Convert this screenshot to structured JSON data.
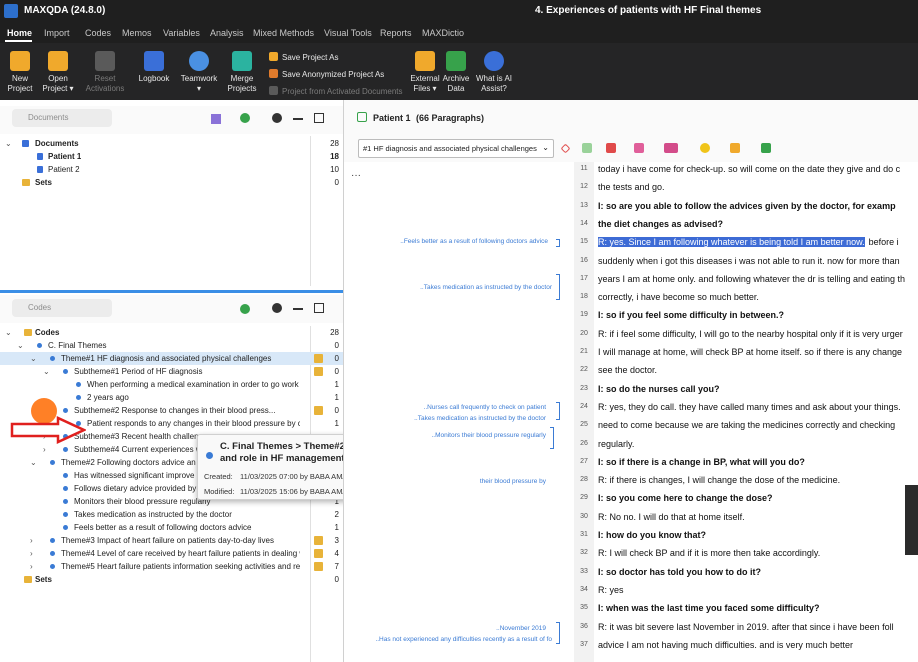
{
  "titlebar": {
    "app": "MAXQDA (24.8.0)",
    "document": "4. Experiences of patients with HF Final themes"
  },
  "menu_tabs": [
    "Home",
    "Import",
    "Codes",
    "Memos",
    "Variables",
    "Analysis",
    "Mixed Methods",
    "Visual Tools",
    "Reports",
    "MAXDictio"
  ],
  "ribbon": {
    "new_project": [
      "New",
      "Project"
    ],
    "open_project": [
      "Open",
      "Project ▾"
    ],
    "reset_activations": [
      "Reset",
      "Activations"
    ],
    "logbook": "Logbook",
    "teamwork": [
      "Teamwork",
      "▾"
    ],
    "merge_projects": [
      "Merge",
      "Projects"
    ],
    "save_project_as": "Save Project As",
    "save_anonymized": "Save Anonymized Project As",
    "project_from_activated": "Project from Activated Documents",
    "external_files": [
      "External",
      "Files ▾"
    ],
    "archive_data": [
      "Archive",
      "Data"
    ],
    "what_is_ai": [
      "What is AI",
      "Assist?"
    ]
  },
  "documents_panel": {
    "search_placeholder": "Documents",
    "rows": [
      {
        "label": "Documents",
        "count": "28"
      },
      {
        "label": "Patient 1",
        "count": "18"
      },
      {
        "label": "Patient 2",
        "count": "10"
      },
      {
        "label": "Sets",
        "count": "0"
      }
    ]
  },
  "codes_panel": {
    "search_placeholder": "Codes",
    "rows": [
      {
        "label": "Codes",
        "count": "28"
      },
      {
        "label": "C. Final Themes",
        "count": "0"
      },
      {
        "label": "Theme#1 HF diagnosis and associated physical challenges",
        "count": "0"
      },
      {
        "label": "Subtheme#1 Period of HF diagnosis",
        "count": "0"
      },
      {
        "label": "When performing a medical examination in order to go work ...",
        "count": "1"
      },
      {
        "label": "2 years ago",
        "count": "1"
      },
      {
        "label": "Subtheme#2 Response to changes in their blood press...",
        "count": "0"
      },
      {
        "label": "Patient responds to any changes in their blood pressure by ch...",
        "count": "1"
      },
      {
        "label": "Subtheme#3 Recent health challen",
        "count": ""
      },
      {
        "label": "Subtheme#4 Current experiences w",
        "count": ""
      },
      {
        "label": "Theme#2 Following doctors advice an",
        "count": ""
      },
      {
        "label": "Has witnessed significant improve",
        "count": ""
      },
      {
        "label": "Follows dietary advice provided by",
        "count": ""
      },
      {
        "label": "Monitors their blood pressure regularly",
        "count": "1"
      },
      {
        "label": "Takes medication as instructed by the doctor",
        "count": "2"
      },
      {
        "label": "Feels better as a result of following doctors advice",
        "count": "1"
      },
      {
        "label": "Theme#3 Impact of heart failure on patients day-to-day lives",
        "count": "3"
      },
      {
        "label": "Theme#4 Level of care received  by heart failure patients in  dealing wi...",
        "count": "4"
      },
      {
        "label": "Theme#5 Heart failure patients information seeking activities and reso...",
        "count": "7"
      },
      {
        "label": "Sets",
        "count": "0"
      }
    ]
  },
  "tooltip": {
    "title": "C. Final Themes > Theme#2 Following doctors advice and role in HF management",
    "created_label": "Created:",
    "created_value": "11/03/2025 07:00 by BABA AMARI",
    "modified_label": "Modified:",
    "modified_value": "11/03/2025 15:06 by BABA AMARI"
  },
  "document_browser": {
    "title": "Patient 1",
    "paragraphs": "(66 Paragraphs)",
    "code_selector": "#1 HF diagnosis and associated physical challenges",
    "margin_labels": [
      "..Feels better as a result of following doctors advice",
      "..Takes medication as instructed by the doctor",
      "..Nurses call frequently to check on patient",
      "..Takes medication as instructed by the doctor",
      "..Monitors their blood pressure regularly",
      "their blood pressure by",
      "..November 2019",
      "..Has not experienced any difficulties recently as a result of fo"
    ],
    "lines": [
      {
        "n": "11",
        "text": "today i have come for check-up. so will come on the date they give and do c",
        "bold": false
      },
      {
        "n": "12",
        "text": "the tests and go.",
        "bold": false
      },
      {
        "n": "13",
        "text": "I: so are you able to follow the advices given by the doctor, for examp",
        "bold": true
      },
      {
        "n": "14",
        "text": "the diet changes as advised?",
        "bold": true
      },
      {
        "n": "15",
        "text": "before i",
        "bold": false,
        "highlight": "R: yes. Since I am following whatever is being told I am better now."
      },
      {
        "n": "16",
        "text": "suddenly when i got this diseases i was not able to run it. now for more than",
        "bold": false
      },
      {
        "n": "17",
        "text": "years I am at home only. and following whatever the dr is telling and eating th",
        "bold": false
      },
      {
        "n": "18",
        "text": "correctly, i have become so much better.",
        "bold": false
      },
      {
        "n": "19",
        "text": "I: so if you feel some difficulty in between.?",
        "bold": true
      },
      {
        "n": "20",
        "text": "R: if i feel some difficulty, I will go to the nearby hospital only if it is very urger",
        "bold": false
      },
      {
        "n": "21",
        "text": "I will manage at home, will check BP at home itself. so if there is any change",
        "bold": false
      },
      {
        "n": "22",
        "text": "see the doctor.",
        "bold": false
      },
      {
        "n": "23",
        "text": "I: so do the nurses call you?",
        "bold": true
      },
      {
        "n": "24",
        "text": "R: yes, they do call. they have called many times and ask about your things.",
        "bold": false
      },
      {
        "n": "25",
        "text": "need to come because we are taking the medicines correctly and checking",
        "bold": false
      },
      {
        "n": "26",
        "text": "regularly.",
        "bold": false
      },
      {
        "n": "27",
        "text": "I: so if there is a change in BP, what will you do?",
        "bold": true
      },
      {
        "n": "28",
        "text": "R: if there is changes, I will change the dose of the medicine.",
        "bold": false
      },
      {
        "n": "29",
        "text": "I: so you come here to change the dose?",
        "bold": true
      },
      {
        "n": "30",
        "text": "R: No no. I will do that at home itself.",
        "bold": false
      },
      {
        "n": "31",
        "text": "I: how do you know that?",
        "bold": true
      },
      {
        "n": "32",
        "text": "R: I will check BP and if it is more then take accordingly.",
        "bold": false
      },
      {
        "n": "33",
        "text": "I: so doctor has told you how to do it?",
        "bold": true
      },
      {
        "n": "34",
        "text": "R: yes",
        "bold": false
      },
      {
        "n": "35",
        "text": "I: when was the last time you faced some difficulty?",
        "bold": true
      },
      {
        "n": "36",
        "text": "R: it was bit severe last November in 2019. after that since i have been foll",
        "bold": false
      },
      {
        "n": "37",
        "text": "advice I am not having much difficulties. and is very much better",
        "bold": false
      }
    ]
  },
  "colors": {
    "accent": "#3a8ee6",
    "highlight": "#3d6bd5",
    "memo": "#e8b339",
    "annotation_dot": "#ff6a00",
    "annotation_arrow": "#e0201e"
  }
}
